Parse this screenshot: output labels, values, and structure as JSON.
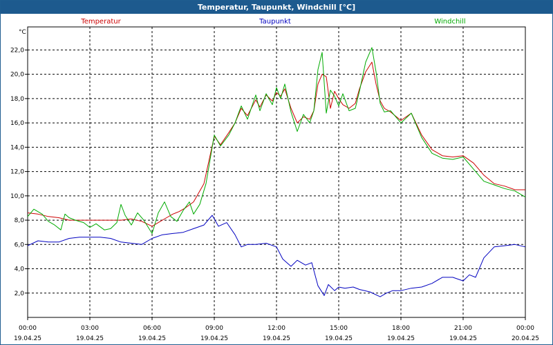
{
  "window": {
    "title": "Temperatur, Taupunkt, Windchill [°C]"
  },
  "chart_data": {
    "type": "line",
    "ylabel": "°C",
    "ylim": [
      0,
      23.5
    ],
    "xlim": [
      0,
      24
    ],
    "grid": true,
    "legend_position": "top",
    "yticks": [
      {
        "value": 2,
        "label": "2,0"
      },
      {
        "value": 4,
        "label": "4,0"
      },
      {
        "value": 6,
        "label": "6,0"
      },
      {
        "value": 8,
        "label": "8,0"
      },
      {
        "value": 10,
        "label": "10,0"
      },
      {
        "value": 12,
        "label": "12,0"
      },
      {
        "value": 14,
        "label": "14,0"
      },
      {
        "value": 16,
        "label": "16,0"
      },
      {
        "value": 18,
        "label": "18,0"
      },
      {
        "value": 20,
        "label": "20,0"
      },
      {
        "value": 22,
        "label": "22,0"
      }
    ],
    "xticks": [
      {
        "hour": 0,
        "time": "00:00",
        "date": "19.04.25"
      },
      {
        "hour": 3,
        "time": "03:00",
        "date": "19.04.25"
      },
      {
        "hour": 6,
        "time": "06:00",
        "date": "19.04.25"
      },
      {
        "hour": 9,
        "time": "09:00",
        "date": "19.04.25"
      },
      {
        "hour": 12,
        "time": "12:00",
        "date": "19.04.25"
      },
      {
        "hour": 15,
        "time": "15:00",
        "date": "19.04.25"
      },
      {
        "hour": 18,
        "time": "18:00",
        "date": "19.04.25"
      },
      {
        "hour": 21,
        "time": "21:00",
        "date": "19.04.25"
      },
      {
        "hour": 24,
        "time": "00:00",
        "date": "20.04.25"
      }
    ],
    "series": [
      {
        "name": "Temperatur",
        "color": "#cc0000",
        "x": [
          0,
          0.5,
          1,
          1.5,
          2,
          2.5,
          3,
          3.5,
          4,
          4.5,
          5,
          5.5,
          6,
          6.3,
          6.7,
          7,
          7.3,
          7.6,
          8,
          8.5,
          9,
          9.3,
          9.7,
          10,
          10.3,
          10.6,
          11,
          11.2,
          11.5,
          11.8,
          12,
          12.2,
          12.4,
          12.7,
          13,
          13.3,
          13.6,
          13.8,
          14,
          14.2,
          14.4,
          14.6,
          14.8,
          15,
          15.2,
          15.5,
          15.8,
          16,
          16.3,
          16.6,
          16.8,
          17,
          17.2,
          17.5,
          18,
          18.5,
          19,
          19.5,
          20,
          20.5,
          21,
          21.5,
          22,
          22.5,
          23,
          23.5,
          24
        ],
        "values": [
          8.6,
          8.5,
          8.3,
          8.2,
          8.0,
          8.0,
          8.0,
          8.0,
          8.0,
          8.0,
          8.1,
          7.9,
          7.5,
          7.8,
          8.2,
          8.5,
          8.7,
          9.0,
          9.5,
          11.0,
          14.9,
          14.2,
          15.2,
          16.0,
          17.2,
          16.6,
          17.9,
          17.3,
          18.3,
          17.8,
          18.5,
          18.2,
          18.8,
          17.2,
          16.0,
          16.5,
          16.3,
          17.0,
          19.2,
          20.0,
          19.8,
          17.2,
          18.6,
          18.0,
          17.5,
          17.2,
          17.6,
          18.8,
          20.2,
          21.0,
          19.2,
          17.8,
          17.2,
          16.9,
          16.2,
          16.8,
          15.0,
          13.8,
          13.3,
          13.2,
          13.3,
          12.7,
          11.7,
          11.0,
          10.8,
          10.5,
          10.5
        ]
      },
      {
        "name": "Taupunkt",
        "color": "#0000c0",
        "x": [
          0,
          0.5,
          1,
          1.5,
          2,
          2.5,
          3,
          3.5,
          4,
          4.5,
          5,
          5.5,
          6,
          6.5,
          7,
          7.5,
          8,
          8.5,
          8.9,
          9.2,
          9.6,
          10,
          10.3,
          10.6,
          11,
          11.5,
          12,
          12.3,
          12.7,
          13,
          13.4,
          13.7,
          14,
          14.3,
          14.5,
          14.8,
          15,
          15.3,
          15.7,
          16,
          16.5,
          17,
          17.3,
          17.6,
          18,
          18.5,
          19,
          19.5,
          20,
          20.5,
          21,
          21.3,
          21.6,
          22,
          22.5,
          23,
          23.5,
          24
        ],
        "values": [
          5.9,
          6.3,
          6.2,
          6.2,
          6.5,
          6.6,
          6.6,
          6.6,
          6.5,
          6.2,
          6.1,
          6.0,
          6.5,
          6.8,
          6.9,
          7.0,
          7.3,
          7.6,
          8.4,
          7.5,
          7.8,
          6.8,
          5.8,
          6.0,
          6.0,
          6.1,
          5.8,
          4.8,
          4.2,
          4.7,
          4.3,
          4.5,
          2.6,
          1.8,
          2.7,
          2.2,
          2.5,
          2.4,
          2.5,
          2.3,
          2.1,
          1.7,
          2.0,
          2.2,
          2.2,
          2.4,
          2.5,
          2.8,
          3.3,
          3.3,
          3.0,
          3.5,
          3.3,
          4.9,
          5.8,
          5.9,
          6.0,
          5.8
        ]
      },
      {
        "name": "Windchill",
        "color": "#00aa00",
        "x": [
          0,
          0.3,
          0.7,
          1,
          1.3,
          1.6,
          1.8,
          2,
          2.3,
          2.7,
          3,
          3.3,
          3.7,
          4,
          4.3,
          4.5,
          4.7,
          5,
          5.3,
          5.6,
          6,
          6.3,
          6.6,
          6.9,
          7.2,
          7.5,
          7.8,
          8,
          8.3,
          8.6,
          9,
          9.3,
          9.7,
          10,
          10.3,
          10.6,
          11,
          11.2,
          11.5,
          11.8,
          12,
          12.2,
          12.4,
          12.7,
          13,
          13.3,
          13.6,
          13.8,
          14,
          14.2,
          14.4,
          14.6,
          14.8,
          15,
          15.2,
          15.5,
          15.8,
          16,
          16.3,
          16.6,
          16.8,
          17,
          17.2,
          17.5,
          18,
          18.5,
          19,
          19.5,
          20,
          20.5,
          21,
          21.5,
          22,
          22.5,
          23,
          23.5,
          24
        ],
        "values": [
          8.3,
          8.9,
          8.5,
          7.9,
          7.6,
          7.2,
          8.5,
          8.2,
          8.0,
          7.8,
          7.4,
          7.7,
          7.2,
          7.3,
          7.8,
          9.3,
          8.4,
          7.6,
          8.6,
          8.0,
          6.9,
          8.6,
          9.5,
          8.3,
          7.9,
          8.8,
          9.5,
          8.5,
          9.3,
          11.0,
          15.0,
          14.1,
          15.0,
          16.0,
          17.4,
          16.3,
          18.3,
          17.0,
          18.4,
          17.5,
          18.9,
          18.0,
          19.2,
          16.9,
          15.3,
          16.7,
          16.0,
          17.0,
          20.4,
          21.8,
          16.8,
          18.7,
          18.2,
          17.4,
          18.4,
          17.0,
          17.2,
          18.6,
          21.0,
          22.2,
          20.2,
          17.6,
          16.9,
          17.0,
          16.0,
          16.8,
          14.8,
          13.5,
          13.1,
          13.0,
          13.2,
          12.2,
          11.2,
          10.9,
          10.6,
          10.4,
          9.9
        ]
      }
    ]
  }
}
